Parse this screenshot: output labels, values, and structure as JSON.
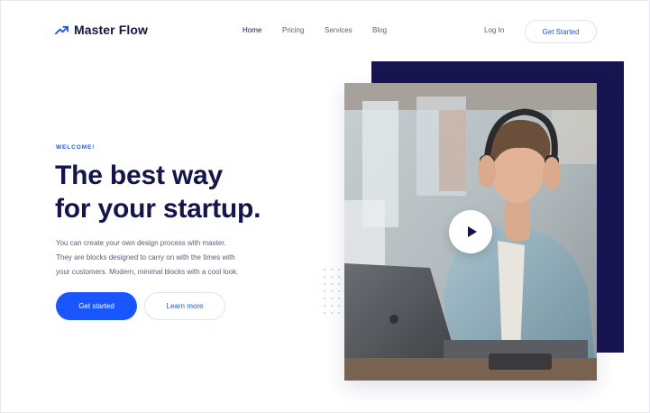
{
  "brand": {
    "name": "Master Flow",
    "logo_icon": "trending-up-icon",
    "accent_color": "#1a56ff",
    "navy_color": "#171550"
  },
  "nav": {
    "items": [
      {
        "label": "Home",
        "active": true
      },
      {
        "label": "Pricing",
        "active": false
      },
      {
        "label": "Services",
        "active": false
      },
      {
        "label": "Blog",
        "active": false
      }
    ],
    "login_label": "Log In",
    "cta_label": "Get Started"
  },
  "hero": {
    "eyebrow": "WELCOME!",
    "headline_lines": [
      "The best way",
      "for your startup."
    ],
    "description_lines": [
      "You can create your own design process with master.",
      "They are blocks designed to carry on with the times with",
      "your customers. Modern, minimal blocks with a cool look."
    ],
    "primary_button": "Get started",
    "secondary_button": "Learn more"
  },
  "media": {
    "image": "photo of man with headphones at laptop",
    "play_icon": "play-icon"
  }
}
